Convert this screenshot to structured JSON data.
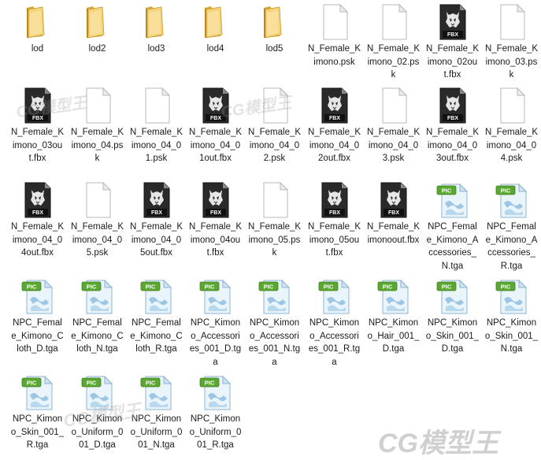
{
  "items": [
    {
      "type": "folder",
      "label": "lod"
    },
    {
      "type": "folder",
      "label": "lod2"
    },
    {
      "type": "folder",
      "label": "lod3"
    },
    {
      "type": "folder",
      "label": "lod4"
    },
    {
      "type": "folder",
      "label": "lod5"
    },
    {
      "type": "blank",
      "label": "N_Female_Kimono.psk"
    },
    {
      "type": "blank",
      "label": "N_Female_Kimono_02.psk"
    },
    {
      "type": "fbx",
      "label": "N_Female_Kimono_02out.fbx"
    },
    {
      "type": "blank",
      "label": "N_Female_Kimono_03.psk"
    },
    {
      "type": "fbx",
      "label": "N_Female_Kimono_03out.fbx"
    },
    {
      "type": "blank",
      "label": "N_Female_Kimono_04.psk"
    },
    {
      "type": "blank",
      "label": "N_Female_Kimono_04_01.psk"
    },
    {
      "type": "fbx",
      "label": "N_Female_Kimono_04_01out.fbx"
    },
    {
      "type": "blank",
      "label": "N_Female_Kimono_04_02.psk"
    },
    {
      "type": "fbx",
      "label": "N_Female_Kimono_04_02out.fbx"
    },
    {
      "type": "blank",
      "label": "N_Female_Kimono_04_03.psk"
    },
    {
      "type": "fbx",
      "label": "N_Female_Kimono_04_03out.fbx"
    },
    {
      "type": "blank",
      "label": "N_Female_Kimono_04_04.psk"
    },
    {
      "type": "fbx",
      "label": "N_Female_Kimono_04_04out.fbx"
    },
    {
      "type": "blank",
      "label": "N_Female_Kimono_04_05.psk"
    },
    {
      "type": "fbx",
      "label": "N_Female_Kimono_04_05out.fbx"
    },
    {
      "type": "fbx",
      "label": "N_Female_Kimono_04out.fbx"
    },
    {
      "type": "blank",
      "label": "N_Female_Kimono_05.psk"
    },
    {
      "type": "fbx",
      "label": "N_Female_Kimono_05out.fbx"
    },
    {
      "type": "fbx",
      "label": "N_Female_Kimonoout.fbx"
    },
    {
      "type": "pic",
      "label": "NPC_Female_Kimono_Accessories_N.tga"
    },
    {
      "type": "pic",
      "label": "NPC_Female_Kimono_Accessories_R.tga"
    },
    {
      "type": "pic",
      "label": "NPC_Female_Kimono_Cloth_D.tga"
    },
    {
      "type": "pic",
      "label": "NPC_Female_Kimono_Cloth_N.tga"
    },
    {
      "type": "pic",
      "label": "NPC_Female_Kimono_Cloth_R.tga"
    },
    {
      "type": "pic",
      "label": "NPC_Kimono_Accessories_001_D.tga"
    },
    {
      "type": "pic",
      "label": "NPC_Kimono_Accessories_001_N.tga"
    },
    {
      "type": "pic",
      "label": "NPC_Kimono_Accessories_001_R.tga"
    },
    {
      "type": "pic",
      "label": "NPC_Kimono_Hair_001_D.tga"
    },
    {
      "type": "pic",
      "label": "NPC_Kimono_Skin_001_D.tga"
    },
    {
      "type": "pic",
      "label": "NPC_Kimono_Skin_001_N.tga"
    },
    {
      "type": "pic",
      "label": "NPC_Kimono_Skin_001_R.tga"
    },
    {
      "type": "pic",
      "label": "NPC_Kimono_Uniform_001_D.tga"
    },
    {
      "type": "pic",
      "label": "NPC_Kimono_Uniform_001_N.tga"
    },
    {
      "type": "pic",
      "label": "NPC_Kimono_Uniform_001_R.tga"
    }
  ],
  "icons": {
    "fbx_badge": "FBX",
    "pic_badge": "PIC"
  },
  "watermark": {
    "text": "CG模型王"
  }
}
